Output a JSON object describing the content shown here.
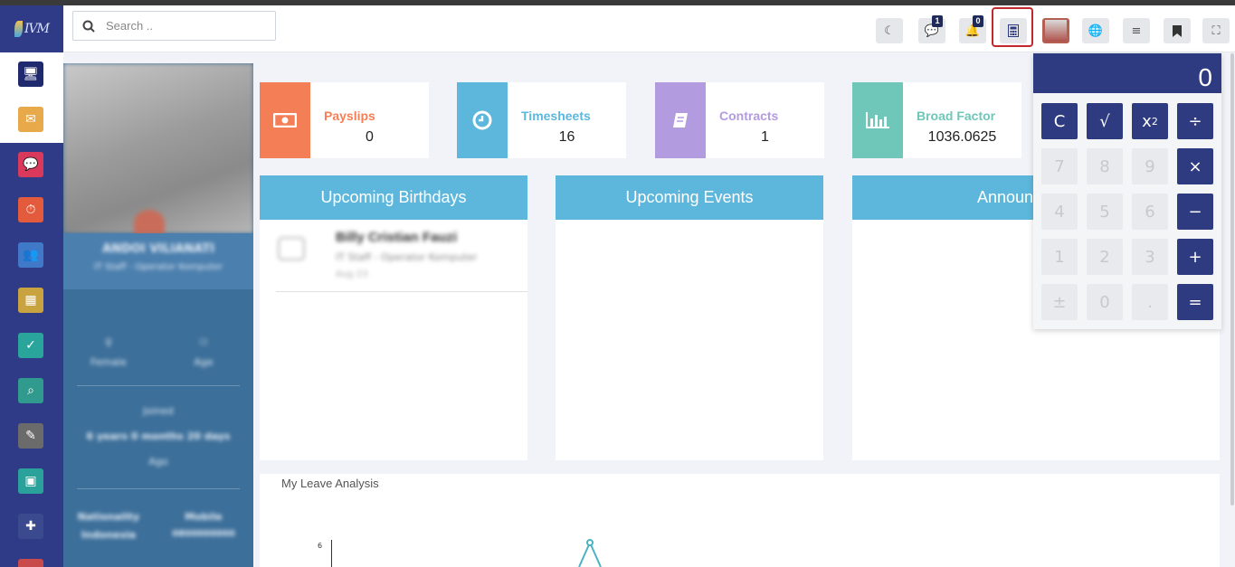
{
  "app": {
    "logo_text": "IVM"
  },
  "search": {
    "placeholder": "Search ..",
    "value": ""
  },
  "topbar": {
    "messages_badge": "1",
    "notifications_badge": "0"
  },
  "stats": [
    {
      "label": "Payslips",
      "value": "0",
      "color": "#f47f56"
    },
    {
      "label": "Timesheets",
      "value": "16",
      "color": "#5db7dc"
    },
    {
      "label": "Contracts",
      "value": "1",
      "color": "#b39be0"
    },
    {
      "label": "Broad Factor",
      "value": "1036.0625",
      "color": "#6fc7b9"
    }
  ],
  "profile": {
    "name": "ANDOI VILIANATI",
    "role": "IT Staff - Operator Komputer",
    "gender": "Female",
    "age": "Age",
    "joined_label": "Joined",
    "tenure": "6 years 0 months 20 days",
    "tenure_suffix": "Ago",
    "nationality_label": "Nationality",
    "nationality_value": "Indonesia",
    "mobile_label": "Mobile",
    "mobile_value": "0800000000"
  },
  "panels": {
    "birthdays_title": "Upcoming Birthdays",
    "events_title": "Upcoming Events",
    "announcements_title": "Announcements",
    "birthday_person": "Billy Cristian Fauzi",
    "birthday_role": "IT Staff - Operator Komputer",
    "birthday_date": "Aug 23"
  },
  "leave": {
    "title": "My Leave Analysis",
    "y_tick": "6"
  },
  "calculator": {
    "display": "0",
    "keys": {
      "clear": "C",
      "sqrt": "√",
      "square_base": "x",
      "square_exp": "2",
      "divide": "÷",
      "k7": "7",
      "k8": "8",
      "k9": "9",
      "multiply": "×",
      "k4": "4",
      "k5": "5",
      "k6": "6",
      "minus": "−",
      "k1": "1",
      "k2": "2",
      "k3": "3",
      "plus": "+",
      "plusminus": "±",
      "k0": "0",
      "dot": ".",
      "equals": "="
    }
  }
}
